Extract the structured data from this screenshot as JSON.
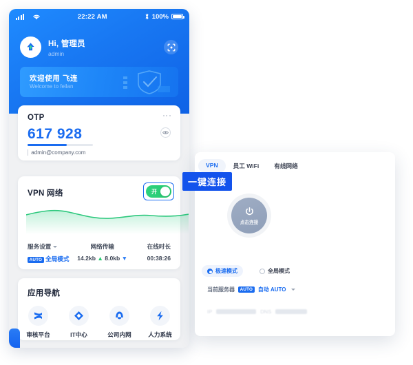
{
  "phone": {
    "status_bar": {
      "time": "22:22 AM",
      "battery_percent": "100%",
      "signal_icon": "cellular-signal-icon",
      "wifi_icon": "wifi-icon",
      "bluetooth_icon": "bluetooth-icon",
      "battery_icon": "battery-icon"
    },
    "header": {
      "greeting": "Hi, 管理员",
      "username": "admin",
      "avatar_icon": "app-logo-icon",
      "scan_icon": "scan-qr-icon"
    },
    "banner": {
      "title": "欢迎使用 飞连",
      "subtitle": "Welcome to feilan",
      "art_icon": "shield-illustration-icon"
    },
    "otp_card": {
      "title": "OTP",
      "code": "617 928",
      "account": "admin@company.com",
      "more_icon": "more-options-icon",
      "eye_icon": "eye-visibility-icon",
      "progress_percent": 60
    },
    "vpn_card": {
      "title": "VPN 网络",
      "toggle_label": "开",
      "toggle_state": "on",
      "stats": [
        {
          "label": "服务设置",
          "value": "全局模式",
          "badge": "AUTO",
          "has_caret": true
        },
        {
          "label": "网络传输",
          "up": "14.2kb",
          "down": "8.0kb"
        },
        {
          "label": "在线时长",
          "value": "00:38:26"
        }
      ]
    },
    "nav_card": {
      "title": "应用导航",
      "items": [
        {
          "label": "审核平台",
          "icon": "review-platform-icon"
        },
        {
          "label": "IT中心",
          "icon": "it-center-diamond-icon"
        },
        {
          "label": "公司内网",
          "icon": "intranet-icon"
        },
        {
          "label": "人力系统",
          "icon": "hr-lightning-icon"
        }
      ]
    }
  },
  "desktop": {
    "tabs": [
      {
        "label": "VPN",
        "active": true
      },
      {
        "label": "员工 WiFi",
        "active": false
      },
      {
        "label": "有线网络",
        "active": false
      }
    ],
    "power_button": {
      "label": "点击连接",
      "icon": "power-icon"
    },
    "modes": [
      {
        "label": "极速模式",
        "selected": true
      },
      {
        "label": "全局模式",
        "selected": false
      }
    ],
    "server": {
      "label": "当前服务器",
      "badge": "AUTO",
      "value": "自动 AUTO",
      "caret_icon": "chevron-down-icon"
    },
    "ipdns": {
      "ip_label": "IP",
      "dns_label": "DNS"
    }
  },
  "callout": {
    "text": "一键连接"
  },
  "colors": {
    "brand_blue": "#1a6cf0",
    "deep_blue": "#1353ec",
    "green": "#25c96f",
    "gray_power": "#9fadc4"
  }
}
